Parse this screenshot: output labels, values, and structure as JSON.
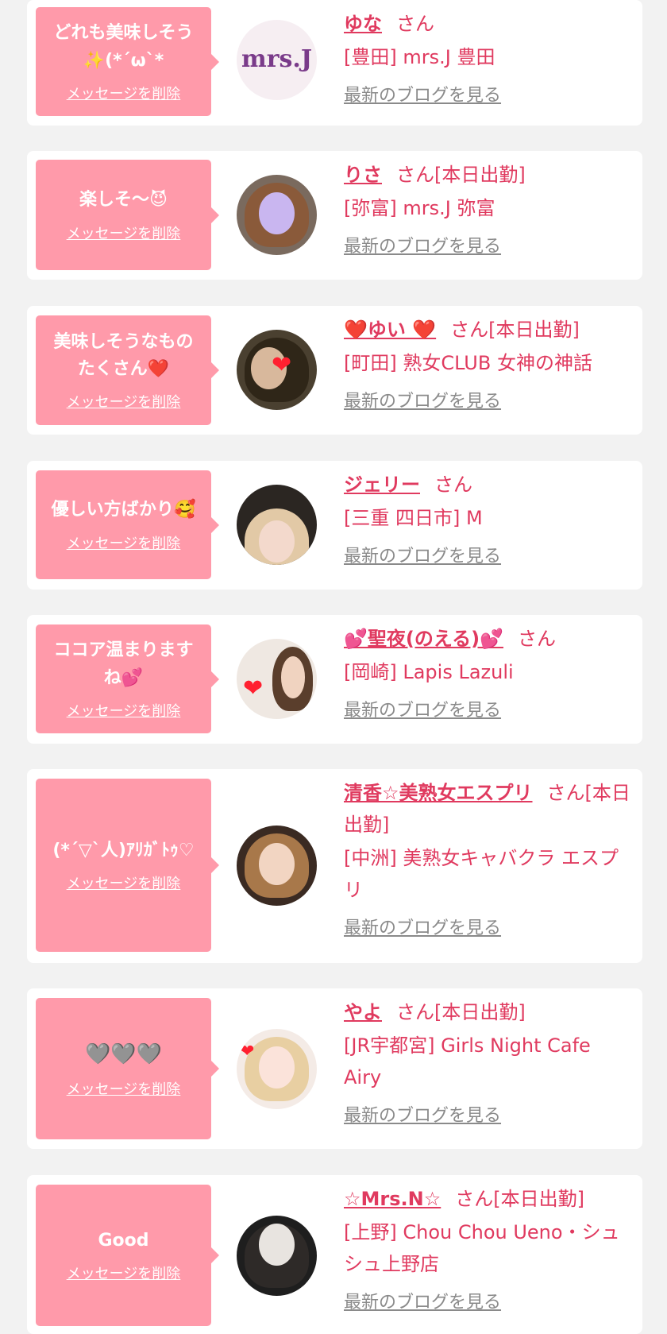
{
  "delete_label": "メッセージを削除",
  "blog_label": "最新のブログを見る",
  "san_label": "さん",
  "accent_color": "#e03a5f",
  "bubble_color": "#ff9aaa",
  "cards": [
    {
      "message": "どれも美味しそう\n✨(*´ω`*",
      "name": "ゆな",
      "suffix": "さん",
      "shop": "[豊田] mrs.J 豊田",
      "avatar_icon": "mrs-j-logo",
      "avatar_text": "mrs.J"
    },
    {
      "message": "楽しそ～😈",
      "name": "りさ",
      "suffix": "さん[本日出勤]",
      "shop": "[弥富] mrs.J 弥富",
      "avatar_icon": "woman-photo"
    },
    {
      "message": "美味しそうなもの\nたくさん❤️",
      "name": "❤️ゆい ❤️",
      "suffix": "さん[本日出勤]",
      "shop": "[町田] 熟女CLUB 女神の神話",
      "avatar_icon": "woman-photo-heart"
    },
    {
      "message": "優しい方ばかり🥰",
      "name": "ジェリー",
      "suffix": "さん",
      "shop": "[三重 四日市] M",
      "avatar_icon": "woman-photo"
    },
    {
      "message": "ココア温まります\nね💕",
      "name": "💕聖夜(のえる)💕",
      "suffix": "さん",
      "shop": "[岡崎] Lapis Lazuli",
      "avatar_icon": "woman-photo-heart"
    },
    {
      "message": "(*´▽`人)ｱﾘｶﾞﾄｩ♡",
      "name": "清香☆美熟女エスプリ",
      "suffix": "さん[本日出勤]",
      "shop": "[中洲] 美熟女キャバクラ エスプリ",
      "avatar_icon": "woman-photo"
    },
    {
      "message": "🩶🩶🩶",
      "name": "やよ",
      "suffix": "さん[本日出勤]",
      "shop": "[JR宇都宮] Girls Night Cafe Airy",
      "avatar_icon": "woman-photo-heart"
    },
    {
      "message": "Good",
      "name": "☆Mrs.N☆",
      "suffix": "さん[本日出勤]",
      "shop": "[上野] Chou Chou Ueno・シュシュ上野店",
      "avatar_icon": "woman-photo"
    }
  ]
}
